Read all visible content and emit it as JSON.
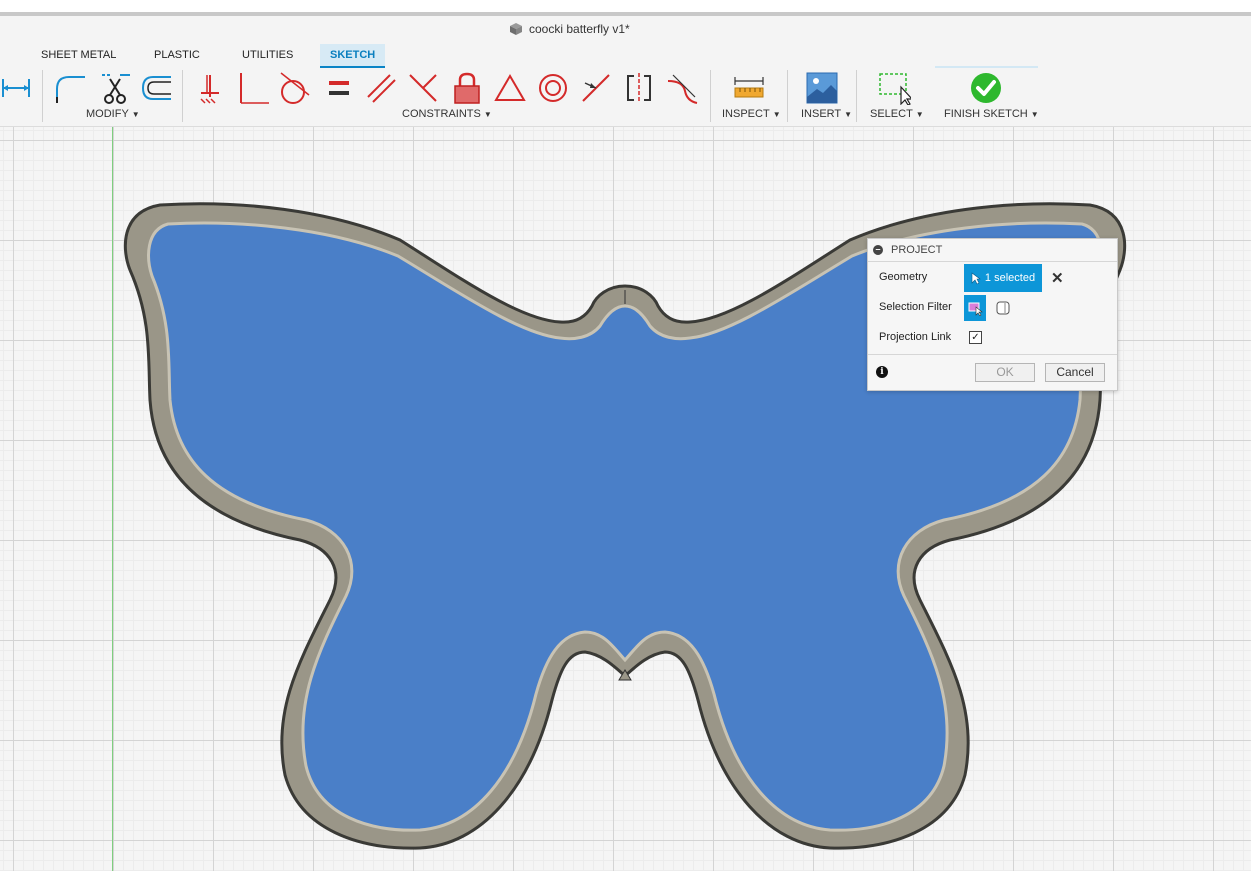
{
  "window": {
    "title": "coocki batterfly v1*"
  },
  "tabs": [
    {
      "label": "SHEET METAL"
    },
    {
      "label": "PLASTIC"
    },
    {
      "label": "UTILITIES"
    },
    {
      "label": "SKETCH",
      "active": true
    }
  ],
  "toolbar": {
    "modify_label": "MODIFY",
    "constraints_label": "CONSTRAINTS",
    "inspect_label": "INSPECT",
    "insert_label": "INSERT",
    "select_label": "SELECT",
    "finish_label": "FINISH SKETCH",
    "icons": [
      "dimension-icon",
      "fillet-icon",
      "trim-icon",
      "offset-icon",
      "coincident-icon",
      "perpendicular-icon",
      "tangent-icon",
      "equal-icon",
      "parallel-icon",
      "perpendicular-lines-icon",
      "fix-lock-icon",
      "triangle-icon",
      "concentric-icon",
      "midpoint-icon",
      "symmetric-icon",
      "curvature-icon",
      "measure-icon",
      "insert-image-icon",
      "select-icon",
      "finish-sketch-icon"
    ]
  },
  "project_dialog": {
    "title": "PROJECT",
    "geometry_label": "Geometry",
    "geometry_value": "1 selected",
    "selection_filter_label": "Selection Filter",
    "projection_link_label": "Projection Link",
    "projection_link_checked": true,
    "ok_label": "OK",
    "cancel_label": "Cancel"
  },
  "colors": {
    "accent": "#0d96d8",
    "fill_blue": "#4a7fc8",
    "frame_gray": "#9a9688",
    "finish_green": "#2eb82e",
    "constraint_red": "#d42a2a"
  }
}
